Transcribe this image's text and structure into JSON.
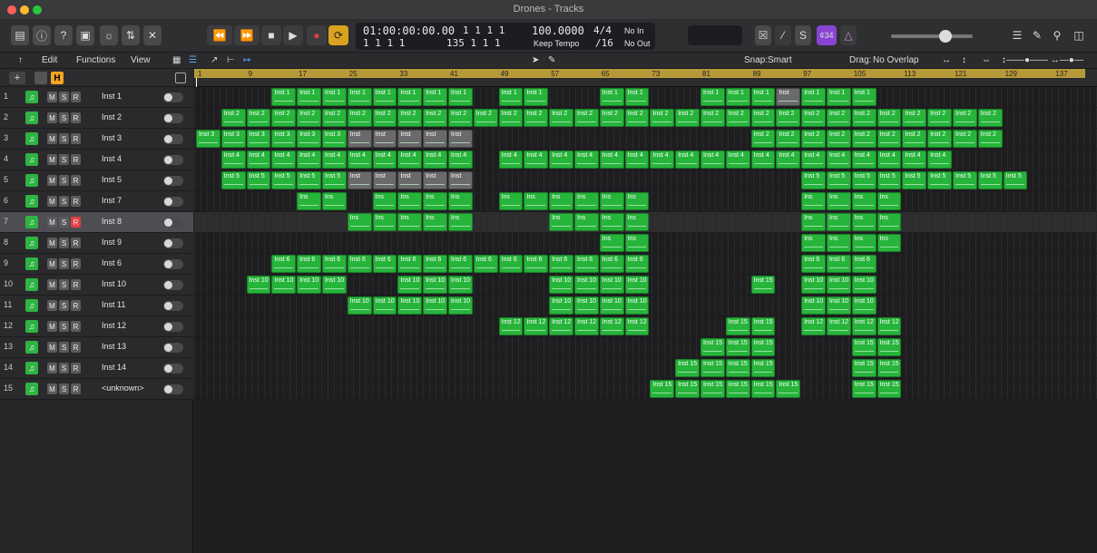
{
  "window": {
    "title": "Drones - Tracks"
  },
  "lcd": {
    "position": "01:00:00:00.00",
    "bars": "1  1  1  1",
    "beats_sub": "1  1  1  1",
    "bars2": "135  1  1  1",
    "tempo": "100.0000",
    "tempo_mode": "Keep Tempo",
    "sig": "4/4",
    "division": "/16",
    "in": "No In",
    "out": "No Out"
  },
  "controlbar": {
    "count_in_label": "¢34"
  },
  "toolbar": {
    "edit": "Edit",
    "functions": "Functions",
    "view": "View",
    "snap_label": "Snap:",
    "snap_value": "Smart",
    "drag_label": "Drag:",
    "drag_value": "No Overlap"
  },
  "ruler": {
    "bars": [
      "1",
      "9",
      "17",
      "25",
      "33",
      "41",
      "49",
      "57",
      "65",
      "73",
      "81",
      "89",
      "97",
      "105",
      "113",
      "121",
      "129",
      "137"
    ]
  },
  "tracks": [
    {
      "num": "1",
      "name": "Inst 1"
    },
    {
      "num": "2",
      "name": "Inst 2"
    },
    {
      "num": "3",
      "name": "Inst 3"
    },
    {
      "num": "4",
      "name": "Inst 4"
    },
    {
      "num": "5",
      "name": "Inst 5"
    },
    {
      "num": "6",
      "name": "Inst 7"
    },
    {
      "num": "7",
      "name": "Inst 8"
    },
    {
      "num": "8",
      "name": "Inst 9"
    },
    {
      "num": "9",
      "name": "Inst 6"
    },
    {
      "num": "10",
      "name": "Inst 10"
    },
    {
      "num": "11",
      "name": "Inst 11"
    },
    {
      "num": "12",
      "name": "Inst 12"
    },
    {
      "num": "13",
      "name": "Inst 13"
    },
    {
      "num": "14",
      "name": "Inst 14"
    },
    {
      "num": "15",
      "name": "<unknown>"
    }
  ],
  "track_buttons": {
    "m": "M",
    "s": "S",
    "r": "R"
  },
  "regions": [
    {
      "row": 0,
      "from": 13,
      "to": 45,
      "label": "Inst 1"
    },
    {
      "row": 0,
      "from": 49,
      "to": 57,
      "label": "Inst 1"
    },
    {
      "row": 0,
      "from": 65,
      "to": 73,
      "label": "Inst 1"
    },
    {
      "row": 0,
      "from": 81,
      "to": 93,
      "label": "Inst 1"
    },
    {
      "row": 0,
      "from": 93,
      "to": 97,
      "label": "Inst",
      "muted": true
    },
    {
      "row": 0,
      "from": 97,
      "to": 109,
      "label": "Inst 1"
    },
    {
      "row": 1,
      "from": 5,
      "to": 129,
      "label": "Inst 2"
    },
    {
      "row": 2,
      "from": 1,
      "to": 25,
      "label": "Inst 3"
    },
    {
      "row": 2,
      "from": 25,
      "to": 45,
      "label": "Inst",
      "muted": true
    },
    {
      "row": 2,
      "from": 89,
      "to": 129,
      "label": "Inst 2"
    },
    {
      "row": 3,
      "from": 5,
      "to": 45,
      "label": "Inst 4"
    },
    {
      "row": 3,
      "from": 49,
      "to": 121,
      "label": "Inst 4"
    },
    {
      "row": 4,
      "from": 5,
      "to": 25,
      "label": "Inst 5"
    },
    {
      "row": 4,
      "from": 25,
      "to": 45,
      "label": "Inst",
      "muted": true
    },
    {
      "row": 4,
      "from": 97,
      "to": 133,
      "label": "Inst 5"
    },
    {
      "row": 5,
      "from": 17,
      "to": 25,
      "label": "Ins"
    },
    {
      "row": 5,
      "from": 29,
      "to": 45,
      "label": "Ins"
    },
    {
      "row": 5,
      "from": 49,
      "to": 73,
      "label": "Ins"
    },
    {
      "row": 5,
      "from": 97,
      "to": 113,
      "label": "Ins"
    },
    {
      "row": 6,
      "from": 25,
      "to": 45,
      "label": "Ins"
    },
    {
      "row": 6,
      "from": 57,
      "to": 73,
      "label": "Ins"
    },
    {
      "row": 6,
      "from": 97,
      "to": 113,
      "label": "Ins"
    },
    {
      "row": 7,
      "from": 65,
      "to": 73,
      "label": "Ins"
    },
    {
      "row": 7,
      "from": 97,
      "to": 113,
      "label": "Ins"
    },
    {
      "row": 8,
      "from": 13,
      "to": 73,
      "label": "Inst 6"
    },
    {
      "row": 8,
      "from": 97,
      "to": 109,
      "label": "Inst 6"
    },
    {
      "row": 9,
      "from": 9,
      "to": 25,
      "label": "Inst 10"
    },
    {
      "row": 9,
      "from": 33,
      "to": 45,
      "label": "Inst 10"
    },
    {
      "row": 9,
      "from": 57,
      "to": 73,
      "label": "Inst 10"
    },
    {
      "row": 9,
      "from": 89,
      "to": 93,
      "label": "Inst 15"
    },
    {
      "row": 9,
      "from": 97,
      "to": 109,
      "label": "Inst 10"
    },
    {
      "row": 10,
      "from": 25,
      "to": 45,
      "label": "Inst 10"
    },
    {
      "row": 10,
      "from": 57,
      "to": 73,
      "label": "Inst 10"
    },
    {
      "row": 10,
      "from": 97,
      "to": 109,
      "label": "Inst 10"
    },
    {
      "row": 11,
      "from": 49,
      "to": 53,
      "label": "Inst 12"
    },
    {
      "row": 11,
      "from": 53,
      "to": 61,
      "label": "Inst 12"
    },
    {
      "row": 11,
      "from": 61,
      "to": 69,
      "label": "Inst 12"
    },
    {
      "row": 11,
      "from": 69,
      "to": 73,
      "label": "Inst 12"
    },
    {
      "row": 11,
      "from": 85,
      "to": 93,
      "label": "Inst 15"
    },
    {
      "row": 11,
      "from": 97,
      "to": 105,
      "label": "Inst 12"
    },
    {
      "row": 11,
      "from": 105,
      "to": 113,
      "label": "Inst 12"
    },
    {
      "row": 12,
      "from": 81,
      "to": 93,
      "label": "Inst 15"
    },
    {
      "row": 12,
      "from": 105,
      "to": 113,
      "label": "Inst 15"
    },
    {
      "row": 13,
      "from": 77,
      "to": 93,
      "label": "Inst 15"
    },
    {
      "row": 13,
      "from": 105,
      "to": 113,
      "label": "Inst 15"
    },
    {
      "row": 14,
      "from": 73,
      "to": 97,
      "label": "Inst 15"
    },
    {
      "row": 14,
      "from": 105,
      "to": 113,
      "label": "Inst 15"
    }
  ],
  "colors": {
    "region": "#27b43b",
    "cycle": "#b79a38",
    "record": "#e04040",
    "accent_yellow": "#f5a623"
  }
}
